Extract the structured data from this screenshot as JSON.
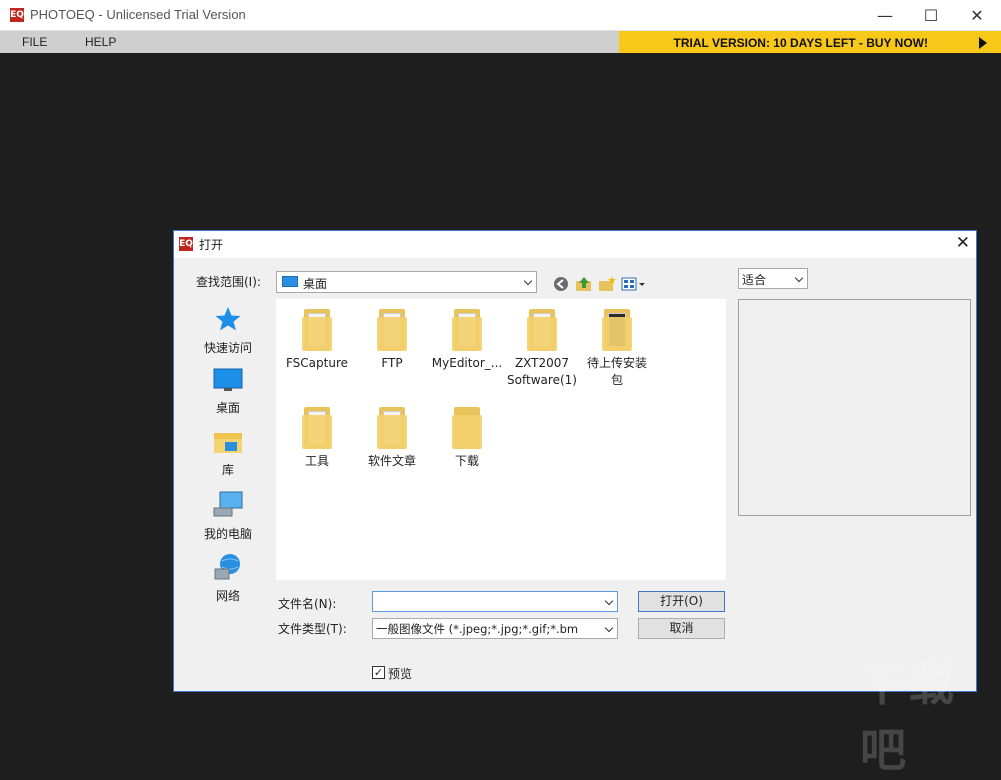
{
  "window": {
    "icon_text": "EQ",
    "title": "PHOTOEQ -  Unlicensed Trial Version",
    "minimize": "—",
    "maximize": "☐",
    "close": "✕"
  },
  "menu": {
    "file": "FILE",
    "help": "HELP"
  },
  "trial_banner": "TRIAL VERSION: 10 DAYS LEFT - BUY NOW!",
  "dialog": {
    "icon_text": "EQ",
    "title": "打开",
    "close": "✕",
    "look_in_label": "查找范围(I):",
    "look_in_value": "桌面",
    "zoom_value": "适合",
    "places": [
      {
        "label": "快速访问",
        "icon": "star-icon"
      },
      {
        "label": "桌面",
        "icon": "desktop-icon"
      },
      {
        "label": "库",
        "icon": "library-icon"
      },
      {
        "label": "我的电脑",
        "icon": "computer-icon"
      },
      {
        "label": "网络",
        "icon": "network-icon"
      }
    ],
    "files": [
      {
        "label": "FSCapture"
      },
      {
        "label": "FTP"
      },
      {
        "label": "MyEditor_..."
      },
      {
        "label": "ZXT2007 Software(1)"
      },
      {
        "label": "待上传安装包"
      },
      {
        "label": "工具"
      },
      {
        "label": "软件文章"
      },
      {
        "label": "下载"
      }
    ],
    "filename_label": "文件名(N):",
    "filename_value": "",
    "filetype_label": "文件类型(T):",
    "filetype_value": "一般图像文件 (*.jpeg;*.jpg;*.gif;*.bm",
    "open_button": "打开(O)",
    "cancel_button": "取消",
    "preview_label": "预览",
    "preview_checked": "✓"
  },
  "watermark": "下载吧"
}
